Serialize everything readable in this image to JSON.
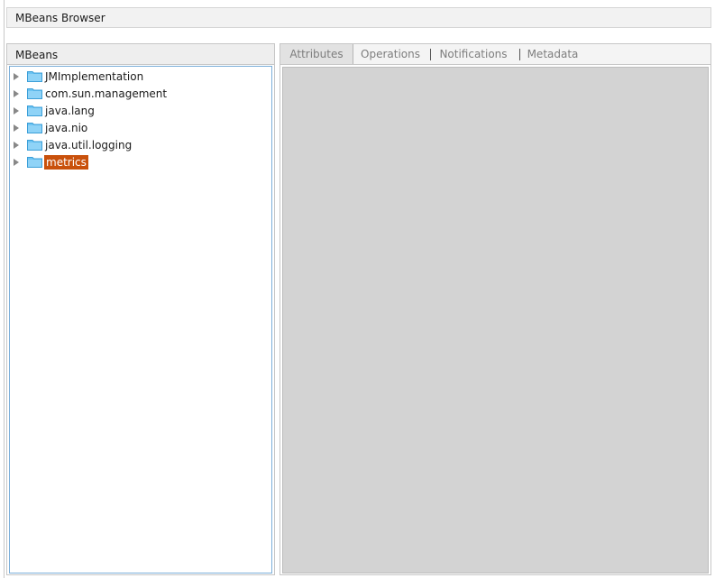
{
  "window": {
    "cut_title": "",
    "browser_title": "MBeans Browser"
  },
  "left_panel": {
    "header": "MBeans",
    "tree": [
      {
        "label": "JMImplementation",
        "selected": false
      },
      {
        "label": "com.sun.management",
        "selected": false
      },
      {
        "label": "java.lang",
        "selected": false
      },
      {
        "label": "java.nio",
        "selected": false
      },
      {
        "label": "java.util.logging",
        "selected": false
      },
      {
        "label": "metrics",
        "selected": true
      }
    ]
  },
  "right_panel": {
    "tabs": [
      {
        "label": "Attributes",
        "active": true
      },
      {
        "label": "Operations",
        "active": false
      },
      {
        "label": "Notifications",
        "active": false
      },
      {
        "label": "Metadata",
        "active": false
      }
    ]
  },
  "colors": {
    "selection": "#c9510c",
    "folder": "#6cc4f3",
    "content_bg": "#d3d3d3",
    "tree_border": "#7aaed9"
  }
}
